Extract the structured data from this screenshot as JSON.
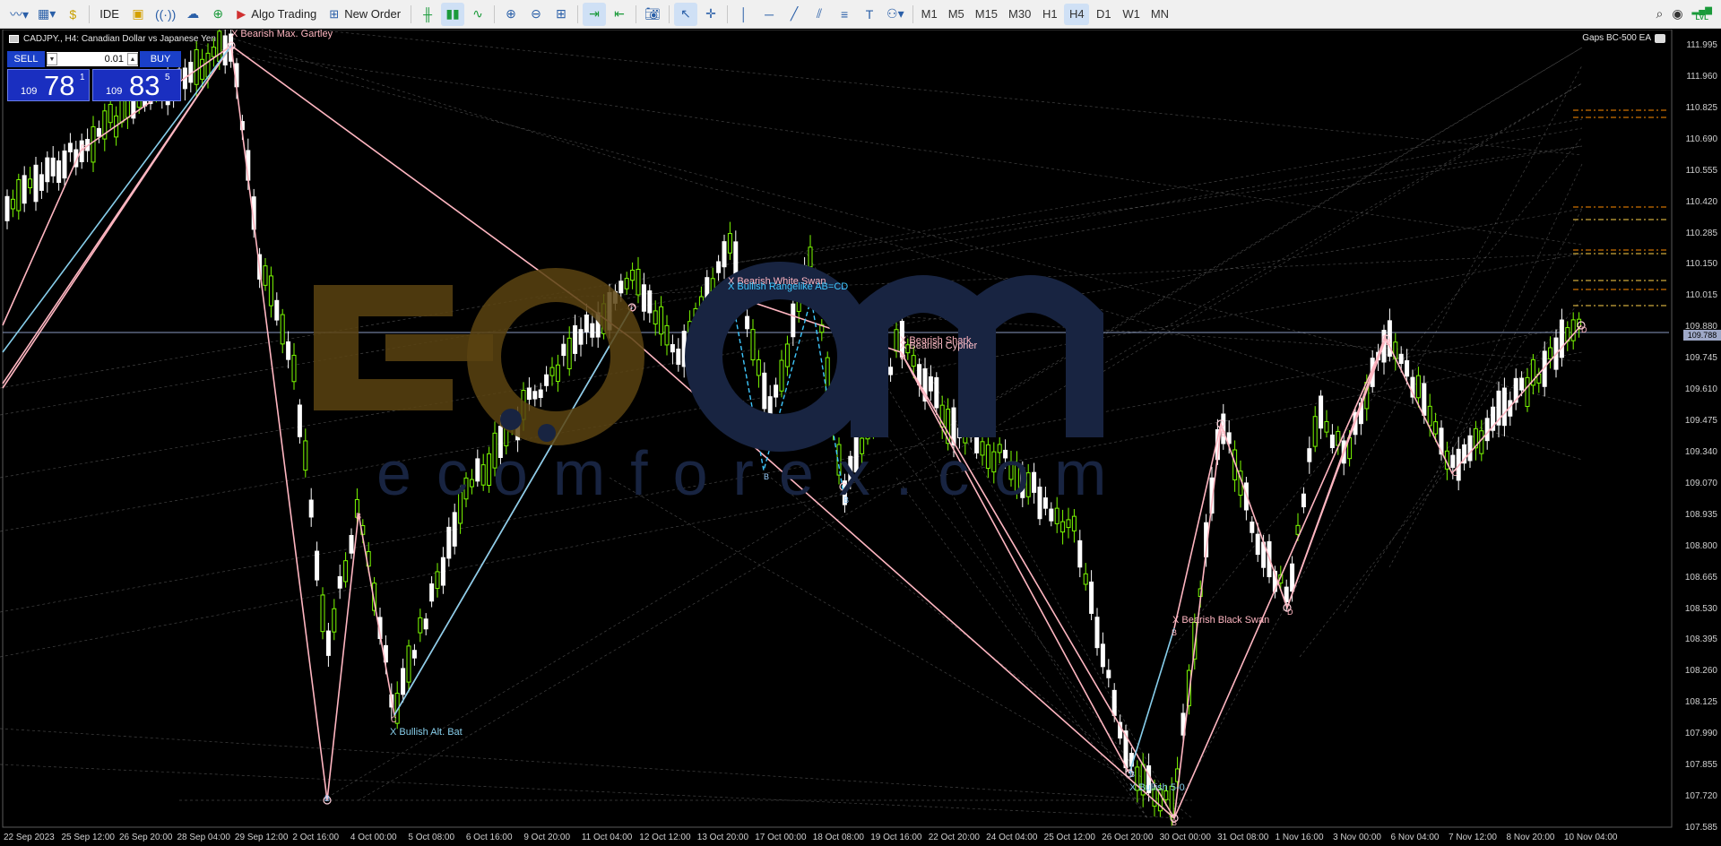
{
  "toolbar": {
    "ide_label": "IDE",
    "algo_trading_label": "Algo Trading",
    "new_order_label": "New Order",
    "text_tool_label": "T",
    "timeframes": [
      "M1",
      "M5",
      "M15",
      "M30",
      "H1",
      "H4",
      "D1",
      "W1",
      "MN"
    ],
    "active_timeframe": "H4",
    "level_badge": "LVL"
  },
  "chart": {
    "symbol_title": "CADJPY., H4:  Canadian Dollar vs Japanese Yen",
    "ea_label": "Gaps BC-500 EA",
    "current_price": "109.788",
    "price_axis": [
      "111.995",
      "111.960",
      "110.825",
      "110.690",
      "110.555",
      "110.420",
      "110.285",
      "110.150",
      "110.015",
      "109.880",
      "109.745",
      "109.610",
      "109.475",
      "109.340",
      "109.070",
      "108.935",
      "108.800",
      "108.665",
      "108.530",
      "108.395",
      "108.260",
      "108.125",
      "107.990",
      "107.855",
      "107.720",
      "107.585"
    ],
    "time_axis": [
      "22 Sep 2023",
      "25 Sep 12:00",
      "26 Sep 20:00",
      "28 Sep 04:00",
      "29 Sep 12:00",
      "2 Oct 16:00",
      "4 Oct 00:00",
      "5 Oct 08:00",
      "6 Oct 16:00",
      "9 Oct 20:00",
      "11 Oct 04:00",
      "12 Oct 12:00",
      "13 Oct 20:00",
      "17 Oct 00:00",
      "18 Oct 08:00",
      "19 Oct 16:00",
      "22 Oct 20:00",
      "24 Oct 04:00",
      "25 Oct 12:00",
      "26 Oct 20:00",
      "30 Oct 00:00",
      "31 Oct 08:00",
      "1 Nov 16:00",
      "3 Nov 00:00",
      "6 Nov 04:00",
      "7 Nov 12:00",
      "8 Nov 20:00",
      "10 Nov 04:00"
    ],
    "watermark_text": "ecomforex.com"
  },
  "trade_panel": {
    "sell_label": "SELL",
    "buy_label": "BUY",
    "lot": "0.01",
    "sell_price_small": "109",
    "sell_price_big": "78",
    "sell_price_sup": "1",
    "buy_price_small": "109",
    "buy_price_big": "83",
    "buy_price_sup": "5"
  },
  "patterns": {
    "bearish_max_gartley": "X Bearish Max. Gartley",
    "bullish_alt_bat": "X Bullish Alt. Bat",
    "bearish_white_swan": "X Bearish White Swan",
    "bullish_rangelike": "X Bullish Rangelike AB=CD",
    "bearish_shark": "X Bearish Shark",
    "bearish_cypher": "X Bearish Cypher",
    "bearish_black_swan": "X Bearish Black Swan",
    "bullish_50": "X Bullish 5-0"
  },
  "points": {
    "b": "B",
    "c": "C",
    "d": "D"
  },
  "colors": {
    "bull_candle": "#7CFC00",
    "bear_candle": "#FFFFFF",
    "bear_pattern": "#FFB6C1",
    "bull_pattern": "#87CEEB",
    "accent": "#2A5FA8"
  }
}
